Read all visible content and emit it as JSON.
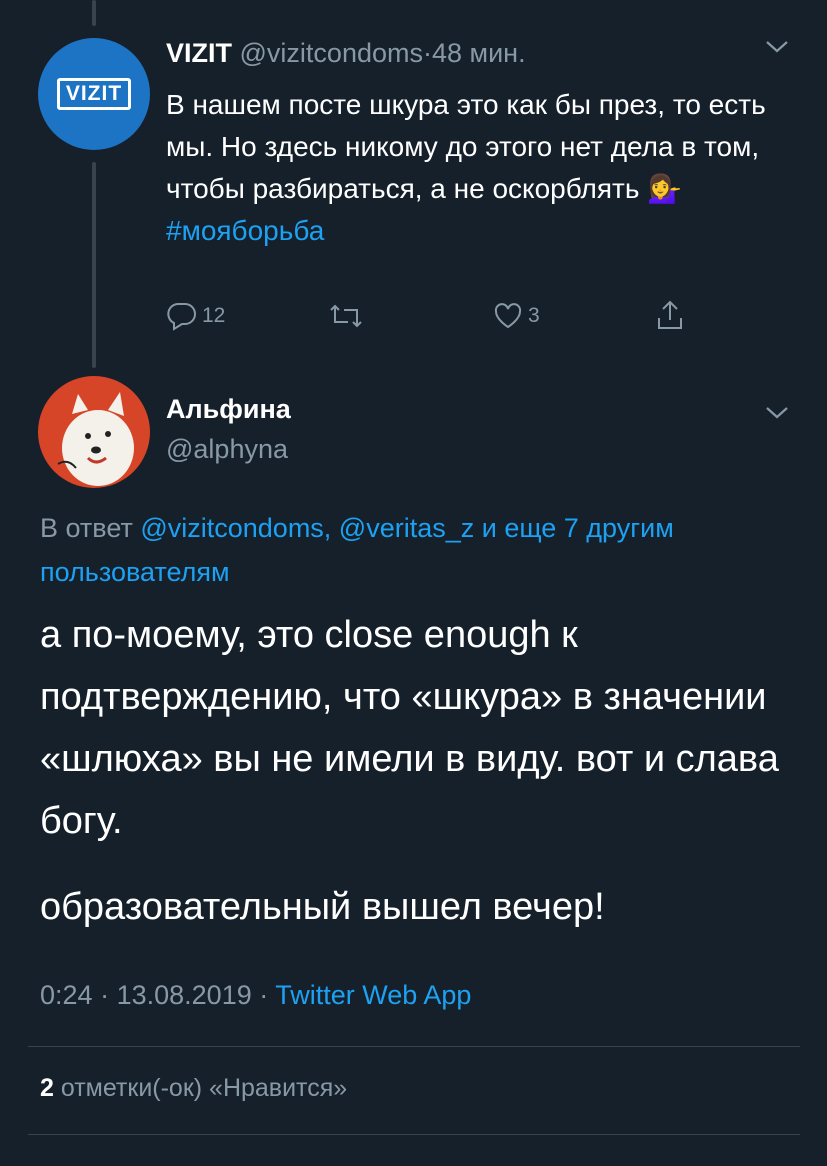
{
  "tweet1": {
    "avatar_text": "VIZIT",
    "name": "VIZIT",
    "handle": "@vizitcondoms",
    "separator": "·",
    "time": "48 мин.",
    "text": "В нашем посте шкура это как бы през, то есть мы. Но здесь никому до этого нет дела в том, чтобы разбираться, а не оскорблять 💁‍♀️",
    "hashtag": "#мояборьба",
    "reply_count": "12",
    "retweet_count": "",
    "like_count": "3"
  },
  "tweet2": {
    "name": "Альфина",
    "handle": "@alphyna",
    "reply_prefix": "В ответ",
    "reply_targets": "@vizitcondoms, @veritas_z и еще 7 другим пользователям",
    "body_p1": "а по-моему, это close enough к подтверждению, что «шкура» в значении «шлюха» вы не имели в виду. вот и слава богу.",
    "body_p2": "образовательный вышел вечер!",
    "time": "0:24",
    "separator": "·",
    "date": "13.08.2019",
    "source": "Twitter Web App",
    "likes_count": "2",
    "likes_label": "отметки(-ок) «Нравится»"
  },
  "icons": [
    "chevron-down-icon",
    "reply-icon",
    "retweet-icon",
    "like-icon",
    "share-icon"
  ],
  "colors": {
    "background": "#15202b",
    "accent": "#1da1f2",
    "muted": "#8899a6",
    "divider": "#38444d",
    "vizit_blue": "#1d74c4",
    "avatar_red": "#d64527"
  }
}
